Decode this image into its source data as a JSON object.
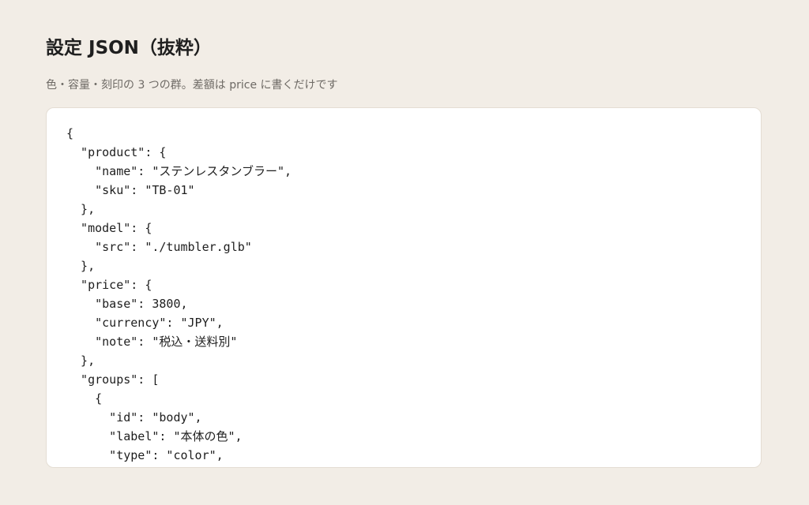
{
  "page": {
    "title": "設定 JSON（抜粋）",
    "subtitle": "色・容量・刻印の 3 つの群。差額は price に書くだけです"
  },
  "code": {
    "lines": [
      "{",
      "  \"product\": {",
      "    \"name\": \"ステンレスタンブラー\",",
      "    \"sku\": \"TB-01\"",
      "  },",
      "  \"model\": {",
      "    \"src\": \"./tumbler.glb\"",
      "  },",
      "  \"price\": {",
      "    \"base\": 3800,",
      "    \"currency\": \"JPY\",",
      "    \"note\": \"税込・送料別\"",
      "  },",
      "  \"groups\": [",
      "    {",
      "      \"id\": \"body\",",
      "      \"label\": \"本体の色\",",
      "      \"type\": \"color\","
    ]
  }
}
